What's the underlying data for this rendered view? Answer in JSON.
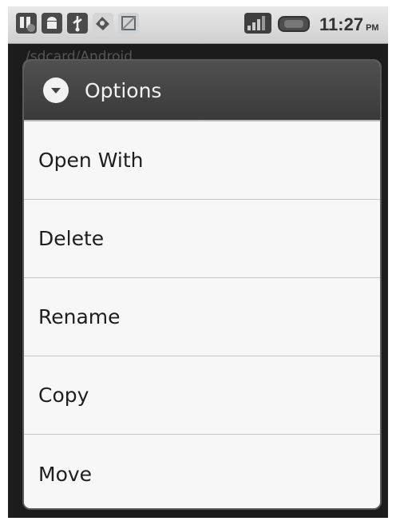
{
  "status_bar": {
    "time": "11:27",
    "ampm": "PM",
    "icons": [
      "usb-debug-icon",
      "android-icon",
      "usb-icon",
      "sd-card-icon",
      "notification-icon"
    ],
    "indicators": [
      "signal-icon",
      "battery-icon"
    ]
  },
  "background": {
    "path": "/sdcard/Android"
  },
  "dialog": {
    "title": "Options",
    "header_icon": "chevron-down-circle-icon",
    "items": [
      {
        "label": "Open With"
      },
      {
        "label": "Delete"
      },
      {
        "label": "Rename"
      },
      {
        "label": "Copy"
      },
      {
        "label": "Move"
      }
    ]
  },
  "colors": {
    "header_bg": "#444444",
    "list_bg": "#f7f7f7",
    "text": "#1e1e1e"
  }
}
